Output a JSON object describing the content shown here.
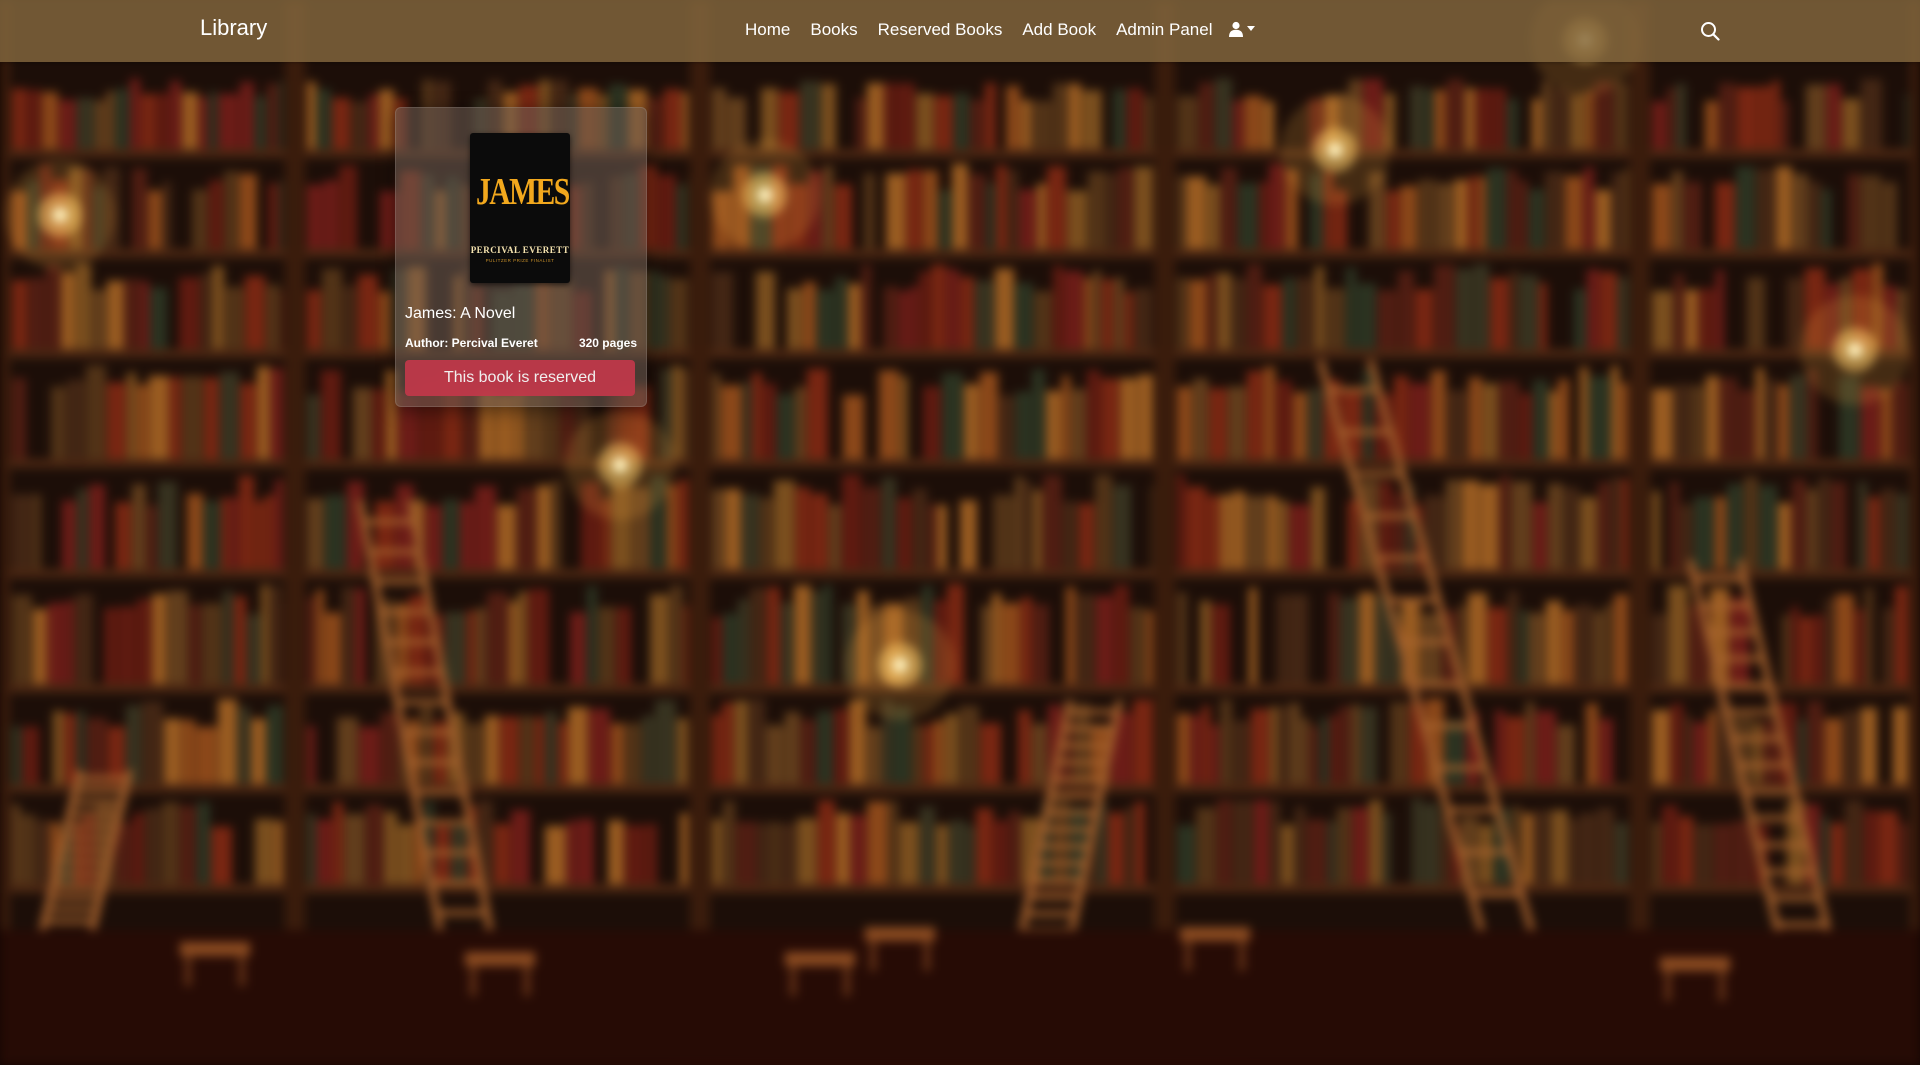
{
  "navbar": {
    "brand": "Library",
    "links": [
      "Home",
      "Books",
      "Reserved Books",
      "Add Book",
      "Admin Panel"
    ],
    "user_icon": "user-icon",
    "search_icon": "search-icon"
  },
  "book": {
    "cover": {
      "title": "JAMES",
      "author": "PERCIVAL EVERETT",
      "subtitle": "PULITZER PRIZE FINALIST"
    },
    "title": "James: A Novel",
    "author": "Author: Percival Everet",
    "pages": "320 pages",
    "status_label": "This book is reserved"
  },
  "colors": {
    "navbar": "#84683e",
    "reserved_button": "#c2384a",
    "cover_accent": "#f2a81d"
  }
}
